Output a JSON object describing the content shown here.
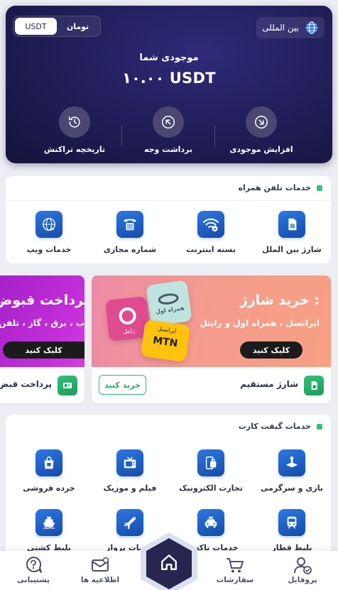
{
  "wallet": {
    "region_label": "بین المللی",
    "currency_options": [
      "تومان",
      "USDT"
    ],
    "selected_currency": "USDT",
    "balance_label": "موجودی شما",
    "balance_value": "۱۰.۰۰ USDT",
    "actions": [
      {
        "label": "افزایش موجودی",
        "icon": "deposit-arrow-icon"
      },
      {
        "label": "برداشت وجه",
        "icon": "withdraw-arrow-icon"
      },
      {
        "label": "تاریخچه تراکنش",
        "icon": "history-icon"
      }
    ]
  },
  "mobile_services": {
    "title": "خدمات تلفن همراه",
    "items": [
      {
        "label": "شارژ بین الملل",
        "icon": "sim-card-icon"
      },
      {
        "label": "بسته اینترنت",
        "icon": "wifi-icon"
      },
      {
        "label": "شماره مجازی",
        "icon": "phone-keypad-icon"
      },
      {
        "label": "خدمات ویپ",
        "icon": "voip-globe-icon"
      }
    ]
  },
  "banners": [
    {
      "title": "خرید شارژ :",
      "subtitle": "ایرانسل ، همراه اول و رایتل",
      "button": "کلیک کنید",
      "footer_label": "شارژ مستقیم",
      "footer_button": "خرید کنید",
      "logos": [
        "همراه اول",
        "ایرانسل",
        "MTN",
        "رایتل"
      ]
    },
    {
      "title": "پرداخت قبوض",
      "subtitle": "آب ، برق ، گاز ، تلفن",
      "button": "کلیک کنید",
      "footer_label": "پرداخت قبض"
    }
  ],
  "gift_services": {
    "title": "خدمات گیفت کارت",
    "items": [
      {
        "label": "بازی و سرگرمی",
        "icon": "game-icon"
      },
      {
        "label": "تجارت الکترونیک",
        "icon": "ecommerce-icon"
      },
      {
        "label": "فیلم و موزیک",
        "icon": "tv-icon"
      },
      {
        "label": "خرده فروشی",
        "icon": "shopping-bag-icon"
      },
      {
        "label": "بلیط قطار",
        "icon": "train-icon"
      },
      {
        "label": "خدمات تاکسی",
        "icon": "taxi-icon"
      },
      {
        "label": "خدمات پرواز",
        "icon": "airplane-icon"
      },
      {
        "label": "بلیط کشتی",
        "icon": "ship-icon"
      }
    ]
  },
  "bottom_nav": {
    "items": [
      {
        "label": "پروفایل",
        "icon": "profile-icon"
      },
      {
        "label": "سفارشات",
        "icon": "cart-icon"
      },
      {
        "label": "اطلاعیه ها",
        "icon": "mail-icon"
      },
      {
        "label": "پشتیبانی",
        "icon": "support-icon"
      }
    ],
    "home_icon": "home-icon"
  },
  "colors": {
    "wallet_bg": "#221f5c",
    "accent_green": "#34c279",
    "icon_blue": "#1f64cc",
    "banner_pink": "#f59b8f",
    "banner_purple": "#c32fd8",
    "nav_home": "#262650"
  }
}
